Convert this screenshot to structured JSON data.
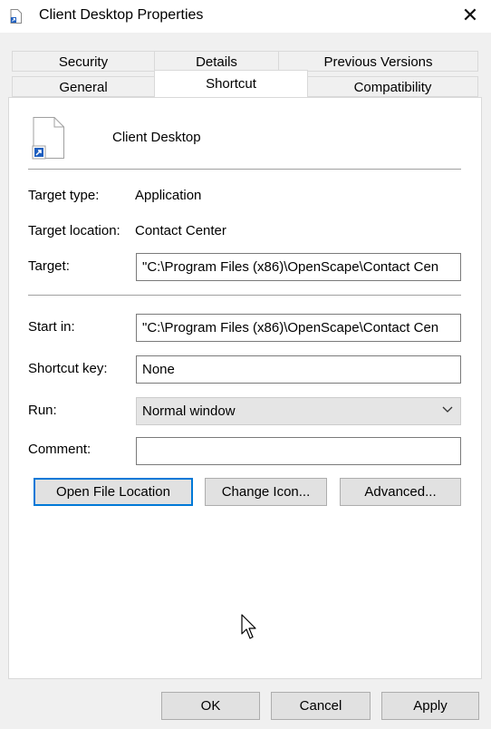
{
  "window": {
    "title": "Client Desktop Properties",
    "close_glyph": "✕"
  },
  "tabs": {
    "back_row": [
      "Security",
      "Details",
      "Previous Versions"
    ],
    "front_row": [
      "General",
      "Shortcut",
      "Compatibility"
    ],
    "active": "Shortcut"
  },
  "header": {
    "name": "Client Desktop",
    "icon": "shortcut-file-icon"
  },
  "fields": {
    "target_type": {
      "label": "Target type:",
      "value": "Application"
    },
    "target_location": {
      "label": "Target location:",
      "value": "Contact Center"
    },
    "target": {
      "label": "Target:",
      "value": "\"C:\\Program Files (x86)\\OpenScape\\Contact Cen"
    },
    "start_in": {
      "label": "Start in:",
      "value": "\"C:\\Program Files (x86)\\OpenScape\\Contact Cen"
    },
    "shortcut_key": {
      "label": "Shortcut key:",
      "value": "None"
    },
    "run": {
      "label": "Run:",
      "value": "Normal window"
    },
    "comment": {
      "label": "Comment:",
      "value": ""
    }
  },
  "buttons": {
    "open_file_location": "Open File Location",
    "change_icon": "Change Icon...",
    "advanced": "Advanced...",
    "ok": "OK",
    "cancel": "Cancel",
    "apply": "Apply"
  },
  "colors": {
    "focus_border": "#0078d7",
    "shortcut_arrow": "#1f5fbf"
  }
}
